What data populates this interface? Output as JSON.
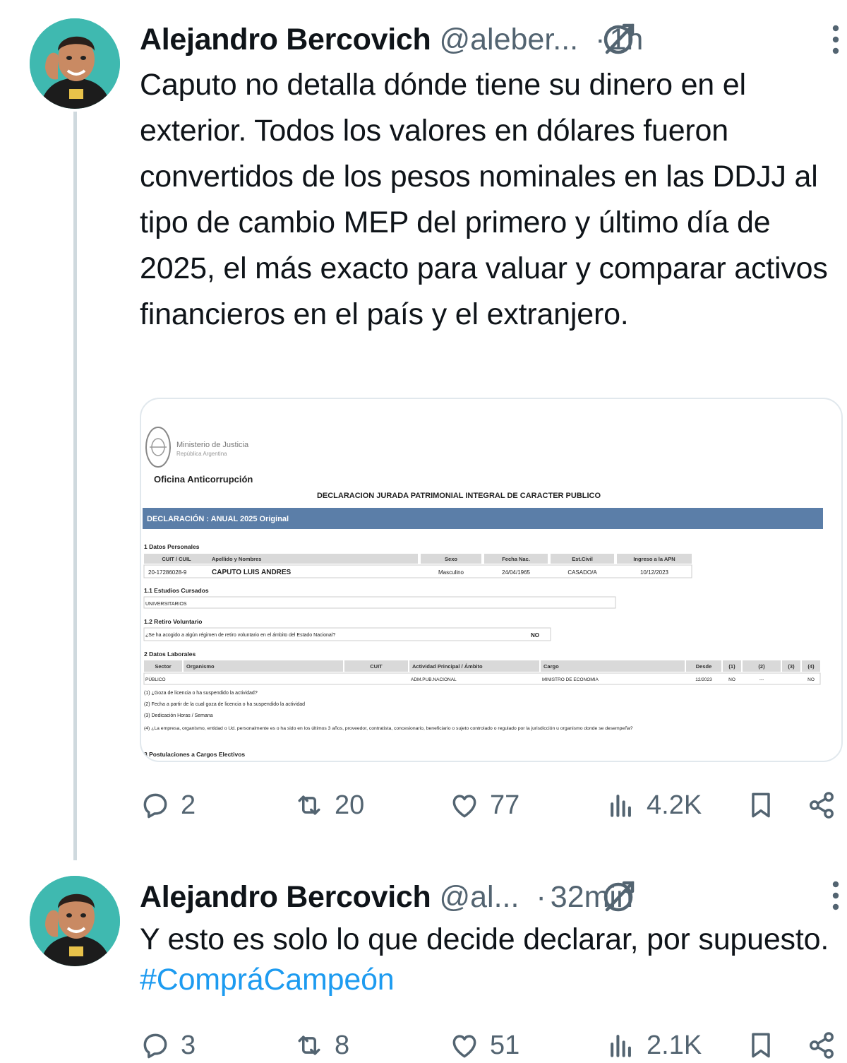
{
  "thread": [
    {
      "author": {
        "name": "Alejandro Bercovich",
        "handle": "@aleber...",
        "separator": "·",
        "time": "1h"
      },
      "text": "Caputo no detalla dónde tiene su dinero en el exterior. Todos los valores en dólares fueron convertidos de los pesos nominales en las DDJJ al tipo de cambio MEP del primero y último día de 2025, el más exacto para valuar y comparar activos financieros en el país y el extranjero.",
      "media": {
        "ministry_line1": "Ministerio de Justicia",
        "ministry_line2": "República Argentina",
        "office": "Oficina Anticorrupción",
        "doc_title": "DECLARACION JURADA PATRIMONIAL INTEGRAL DE CARACTER PUBLICO",
        "banner": "DECLARACIÓN :   ANUAL 2025 Original",
        "section_personal": "1 Datos Personales",
        "personal_headers": [
          "CUIT / CUIL",
          "Apellido y Nombres",
          "Sexo",
          "Fecha Nac.",
          "Est.Civil",
          "Ingreso a la APN"
        ],
        "personal_values": [
          "20-17286028-9",
          "CAPUTO LUIS ANDRES",
          "Masculino",
          "24/04/1965",
          "CASADO/A",
          "10/12/2023"
        ],
        "section_studies": "1.1 Estudios Cursados",
        "studies_value": "UNIVERSITARIOS",
        "section_retirement": "1.2 Retiro Voluntario",
        "retirement_question": "¿Se ha acogido a algún régimen de retiro voluntario en el ámbito del Estado Nacional?",
        "retirement_answer": "NO",
        "section_work": "2 Datos Laborales",
        "work_headers": [
          "Sector",
          "Organismo",
          "CUIT",
          "Actividad Principal / Ámbito",
          "Cargo",
          "Desde",
          "(1)",
          "(2)",
          "(3)",
          "(4)"
        ],
        "work_values": [
          "PÚBLICO",
          "",
          "",
          "ADM.PUB.NACIONAL",
          "MINISTRO DE ECONOMIA",
          "12/2023",
          "NO",
          "---",
          "",
          "NO"
        ],
        "notes": [
          "(1) ¿Goza de licencia o ha suspendido la actividad?",
          "(2) Fecha a partir de la cual goza de licencia o ha suspendido la actividad",
          "(3) Dedicación Horas / Semana",
          "(4) ¿La empresa, organismo, entidad o Ud. personalmente es o ha sido en los últimos 3 años, proveedor, contratista, concesionario, beneficiario o sujeto controlado o regulado por la jurisdicción u organismo donde se desempeña?"
        ],
        "section_elective": "3 Postulaciones a Cargos Electivos"
      },
      "stats": {
        "replies": "2",
        "reposts": "20",
        "likes": "77",
        "views": "4.2K"
      }
    },
    {
      "author": {
        "name": "Alejandro Bercovich",
        "handle": "@al...",
        "separator": "·",
        "time": "32min"
      },
      "text_plain": "Y esto es solo lo que decide declarar, por supuesto. ",
      "hashtag": "#CompráCampeón",
      "stats": {
        "replies": "3",
        "reposts": "8",
        "likes": "51",
        "views": "2.1K"
      }
    }
  ],
  "colors": {
    "accent": "#1d9bf0",
    "secondary_text": "#536471",
    "thread_line": "#cfd9de",
    "doc_banner": "#5b7ea8"
  },
  "icons": [
    "grok-icon",
    "more-icon",
    "reply-icon",
    "repost-icon",
    "like-icon",
    "views-icon",
    "bookmark-icon",
    "share-icon"
  ]
}
